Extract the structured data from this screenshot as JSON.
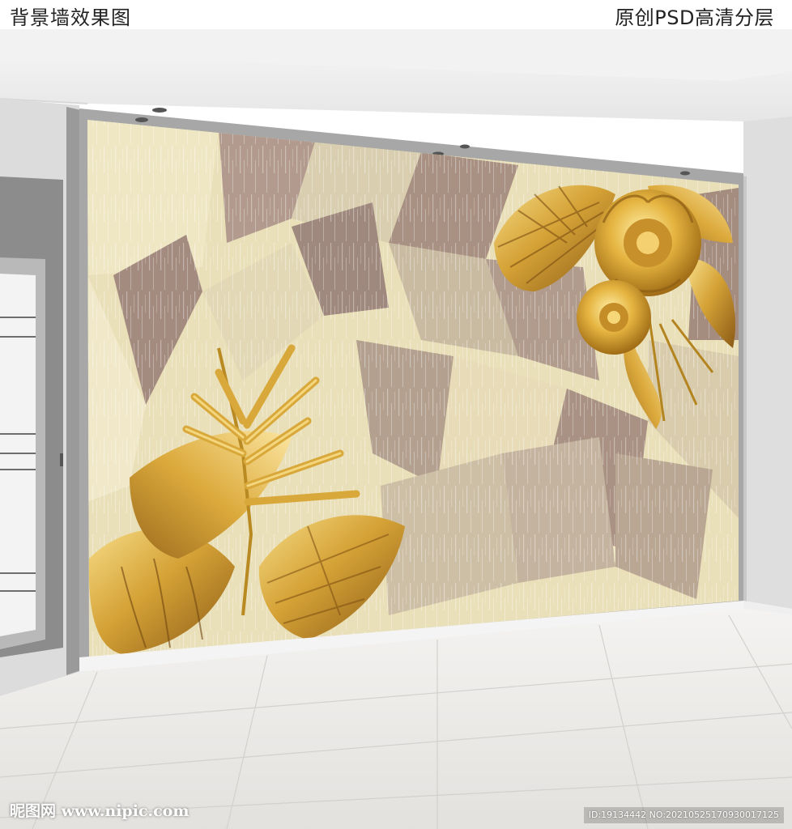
{
  "header": {
    "title": "背景墙效果图",
    "subtitle": "原创PSD高清分层"
  },
  "footer": {
    "site_logo": "昵图网 www.nipic.com",
    "image_id": "ID:19134442 NO:20210525170930017125"
  },
  "colors": {
    "gold": "#c9962a",
    "gold_light": "#f2d27a",
    "wall_cream": "#e9dfb8",
    "wall_mauve": "#a89082",
    "floor": "#ecebe8"
  }
}
